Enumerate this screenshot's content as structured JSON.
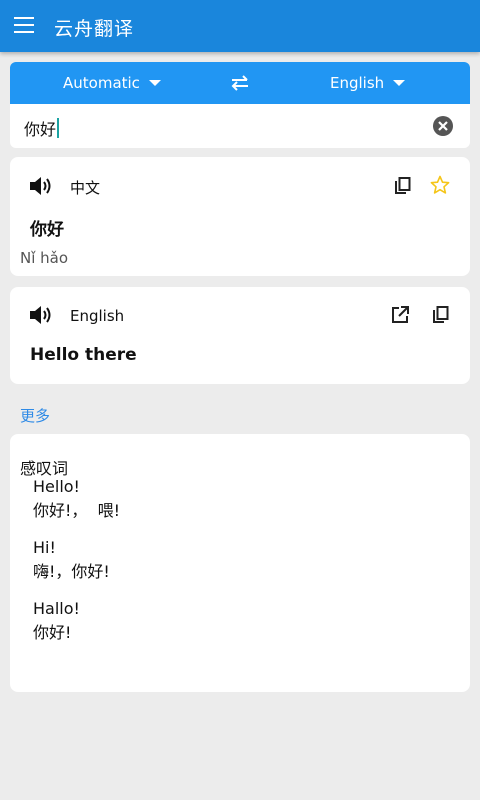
{
  "app": {
    "title": "云舟翻译"
  },
  "lang_bar": {
    "source": "Automatic",
    "target": "English"
  },
  "input": {
    "text": "你好"
  },
  "source_card": {
    "language": "中文",
    "text": "你好",
    "pinyin": "Nǐ hǎo"
  },
  "target_card": {
    "language": "English",
    "text": "Hello there"
  },
  "more": {
    "label": "更多"
  },
  "dictionary": {
    "pos": "感叹词",
    "lines": [
      "Hello!",
      "你好!，  喂!",
      "Hi!",
      "嗨!，你好!",
      "Hallo!",
      "你好!"
    ]
  },
  "colors": {
    "appbar": "#1a86dc",
    "lang_bar": "#2196f3",
    "accent_link": "#2e8ae6",
    "star": "#f5c518",
    "background": "#ececec"
  },
  "icons": [
    "menu-icon",
    "swap-icon",
    "clear-icon",
    "speaker-icon",
    "copy-icon",
    "star-icon",
    "open-external-icon"
  ]
}
